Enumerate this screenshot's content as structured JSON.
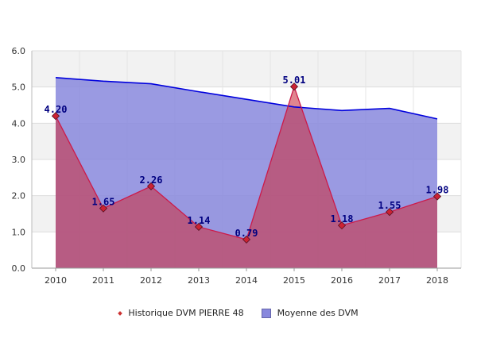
{
  "chart_data": {
    "type": "area",
    "categories": [
      "2010",
      "2011",
      "2012",
      "2013",
      "2014",
      "2015",
      "2016",
      "2017",
      "2018"
    ],
    "series": [
      {
        "name": "Historique DVM PIERRE 48",
        "values": [
          4.2,
          1.65,
          2.26,
          1.14,
          0.79,
          5.01,
          1.18,
          1.55,
          1.98
        ],
        "labels": [
          "4.20",
          "1.65",
          "2.26",
          "1.14",
          "0.79",
          "5.01",
          "1.18",
          "1.55",
          "1.98"
        ],
        "color": "#cc1a4a",
        "fill": "#cc3344"
      },
      {
        "name": "Moyenne des DVM",
        "values": [
          5.26,
          5.16,
          5.09,
          4.87,
          4.66,
          4.45,
          4.35,
          4.41,
          4.12
        ],
        "color": "#0000dd",
        "fill": "#8888dd"
      }
    ],
    "yticks": [
      "0.0",
      "1.0",
      "2.0",
      "3.0",
      "4.0",
      "5.0",
      "6.0"
    ],
    "ylim": [
      0,
      6
    ],
    "grid": true,
    "legend_position": "bottom"
  }
}
